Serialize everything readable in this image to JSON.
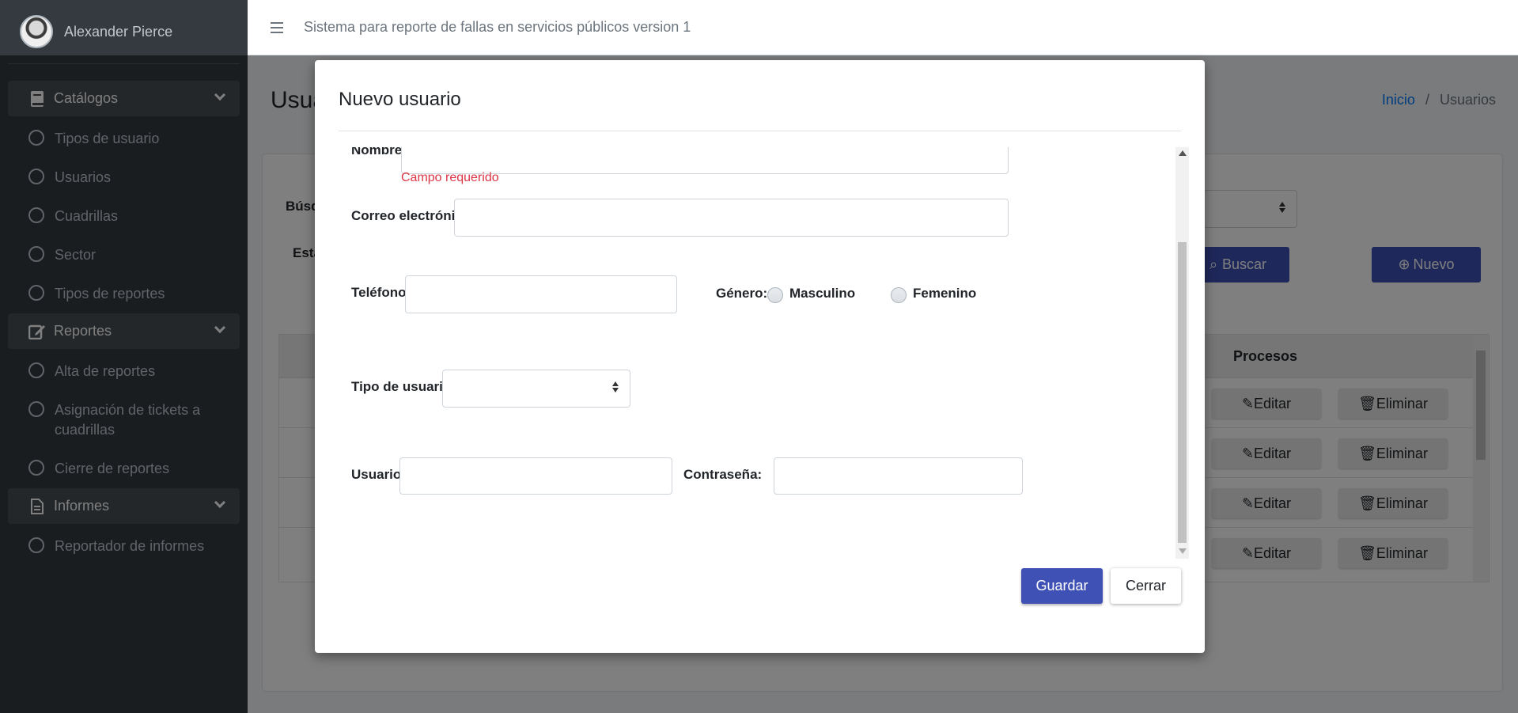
{
  "sidebar": {
    "user_name": "Alexander Pierce",
    "groups": [
      {
        "label": "Catálogos",
        "icon": "book-icon"
      },
      {
        "label": "Reportes",
        "icon": "edit-icon"
      },
      {
        "label": "Informes",
        "icon": "file-icon"
      }
    ],
    "catalogos_items": [
      "Tipos de usuario",
      "Usuarios",
      "Cuadrillas",
      "Sector",
      "Tipos de reportes"
    ],
    "reportes_items": [
      "Alta de reportes",
      "Asignación de tickets a cuadrillas",
      "Cierre de reportes"
    ],
    "informes_items": [
      "Reportador de informes"
    ]
  },
  "header": {
    "title": "Sistema para reporte de fallas en servicios públicos version 1"
  },
  "page": {
    "title": "Usua",
    "breadcrumb": {
      "home": "Inicio",
      "separator": "/",
      "current": "Usuarios"
    },
    "search_label": "Búsq",
    "status_label": "Esta",
    "search_button": "Buscar",
    "new_button": "Nuevo",
    "table_header_procesos": "Procesos",
    "row_edit": "Editar",
    "row_delete": "Eliminar"
  },
  "modal": {
    "title": "Nuevo usuario",
    "fields": {
      "nombre_label": "Nombre:",
      "nombre_error": "Campo requerido",
      "correo_label": "Correo electrónico:",
      "telefono_label": "Teléfono:",
      "genero_label": "Género:",
      "genero_options": [
        "Masculino",
        "Femenino"
      ],
      "tipo_usuario_label": "Tipo de usuario",
      "usuario_label": "Usuario:",
      "contrasena_label": "Contraseña:"
    },
    "save_button": "Guardar",
    "close_button": "Cerrar"
  },
  "colors": {
    "primary": "#3f51b5",
    "sidebar": "#343a40",
    "error": "#dc3545",
    "link": "#007bff"
  }
}
